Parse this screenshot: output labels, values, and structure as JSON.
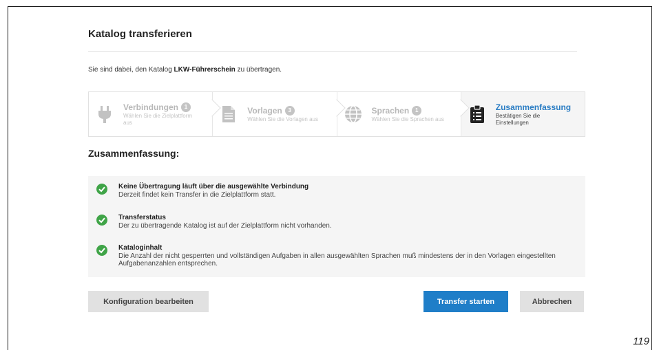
{
  "dialog": {
    "title": "Katalog transferieren",
    "intro_prefix": "Sie sind dabei, den Katalog ",
    "catalog_name": "LKW-Führerschein",
    "intro_suffix": " zu übertragen."
  },
  "steps": [
    {
      "name": "Verbindungen",
      "badge": "1",
      "desc": "Wählen Sie die Zielplattform aus",
      "icon": "plug-icon"
    },
    {
      "name": "Vorlagen",
      "badge": "3",
      "desc": "Wählen Sie die Vorlagen aus",
      "icon": "document-icon"
    },
    {
      "name": "Sprachen",
      "badge": "1",
      "desc": "Wählen Sie die Sprachen aus",
      "icon": "globe-icon"
    },
    {
      "name": "Zusammenfassung",
      "desc": "Bestätigen Sie die Einstellungen",
      "icon": "clipboard-icon"
    }
  ],
  "summary": {
    "heading": "Zusammenfassung:",
    "checks": [
      {
        "title": "Keine Übertragung läuft über die ausgewählte Verbindung",
        "desc": "Derzeit findet kein Transfer in die Zielplattform statt."
      },
      {
        "title": "Transferstatus",
        "desc": "Der zu übertragende Katalog ist auf der Zielplattform nicht vorhanden."
      },
      {
        "title": "Kataloginhalt",
        "desc": "Die Anzahl der nicht gesperrten und vollständigen Aufgaben in allen ausgewählten Sprachen muß mindestens der in den Vorlagen eingestellten Aufgabenanzahlen entsprechen."
      }
    ]
  },
  "buttons": {
    "edit": "Konfiguration bearbeiten",
    "start": "Transfer starten",
    "cancel": "Abbrechen"
  },
  "colors": {
    "accent": "#1f7ec8",
    "success": "#3fa447"
  },
  "page_number": "119"
}
